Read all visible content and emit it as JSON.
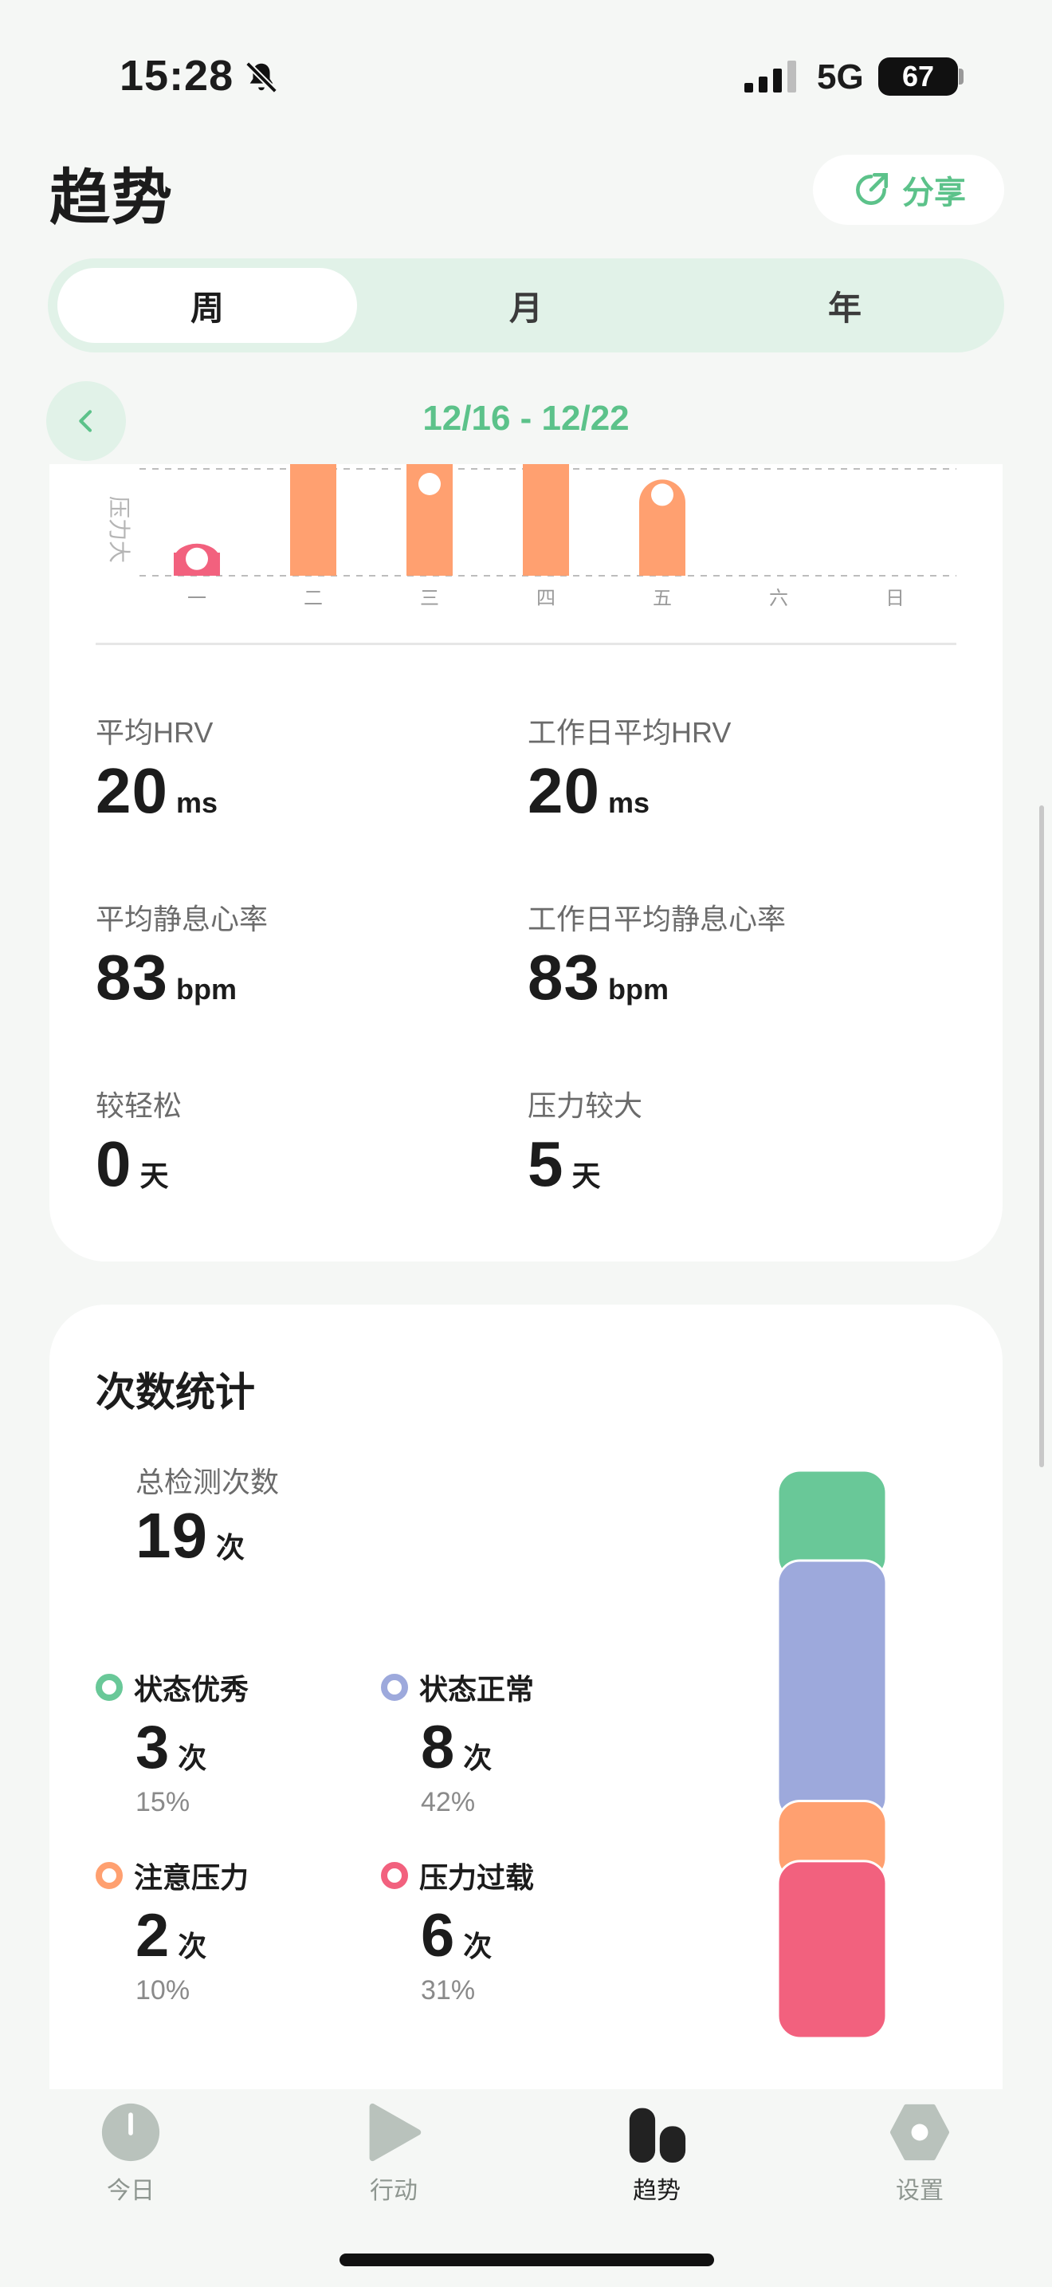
{
  "status_bar": {
    "time": "15:28",
    "network": "5G",
    "battery": "67"
  },
  "header": {
    "title": "趋势",
    "share_label": "分享"
  },
  "tabs": [
    {
      "label": "周",
      "active": true
    },
    {
      "label": "月",
      "active": false
    },
    {
      "label": "年",
      "active": false
    }
  ],
  "date_range": "12/16 - 12/22",
  "stress_chart": {
    "y_label": "压力大",
    "days": [
      "一",
      "二",
      "三",
      "四",
      "五",
      "六",
      "日"
    ],
    "colors": {
      "overload": "#f2617e",
      "attention": "#ffa070"
    }
  },
  "chart_data": {
    "type": "bar",
    "categories": [
      "一",
      "二",
      "三",
      "四",
      "五",
      "六",
      "日"
    ],
    "ylabel": "压力大",
    "series": [
      {
        "values": [
          0.3,
          1.0,
          1.0,
          1.0,
          0.9,
          0,
          0
        ]
      }
    ],
    "bar_colors": [
      "#f2617e",
      "#ffa070",
      "#ffa070",
      "#ffa070",
      "#ffa070",
      null,
      null
    ],
    "markers": [
      0.3,
      null,
      1.0,
      null,
      0.9,
      null,
      null
    ],
    "ylim": [
      0,
      1
    ],
    "grid": "dashed"
  },
  "stats": {
    "avg_hrv": {
      "label": "平均HRV",
      "value": "20",
      "unit": "ms"
    },
    "workday_avg_hrv": {
      "label": "工作日平均HRV",
      "value": "20",
      "unit": "ms"
    },
    "avg_resting_hr": {
      "label": "平均静息心率",
      "value": "83",
      "unit": "bpm"
    },
    "workday_avg_resting_hr": {
      "label": "工作日平均静息心率",
      "value": "83",
      "unit": "bpm"
    },
    "relaxed_days": {
      "label": "较轻松",
      "value": "0",
      "unit": "天"
    },
    "stressed_days": {
      "label": "压力较大",
      "value": "5",
      "unit": "天"
    }
  },
  "count_stats": {
    "title": "次数统计",
    "total_label": "总检测次数",
    "total_value": "19",
    "total_unit": "次",
    "categories": [
      {
        "label": "状态优秀",
        "value": "3",
        "unit": "次",
        "percent": "15%",
        "count": 3,
        "color": "#69c898"
      },
      {
        "label": "状态正常",
        "value": "8",
        "unit": "次",
        "percent": "42%",
        "count": 8,
        "color": "#9da9dc"
      },
      {
        "label": "注意压力",
        "value": "2",
        "unit": "次",
        "percent": "10%",
        "count": 2,
        "color": "#ffa070"
      },
      {
        "label": "压力过载",
        "value": "6",
        "unit": "次",
        "percent": "31%",
        "count": 6,
        "color": "#f2617e"
      }
    ]
  },
  "nav": [
    {
      "label": "今日",
      "icon": "clock-icon",
      "active": false
    },
    {
      "label": "行动",
      "icon": "play-icon",
      "active": false
    },
    {
      "label": "趋势",
      "icon": "bar-chart-icon",
      "active": true
    },
    {
      "label": "设置",
      "icon": "gear-icon",
      "active": false
    }
  ]
}
